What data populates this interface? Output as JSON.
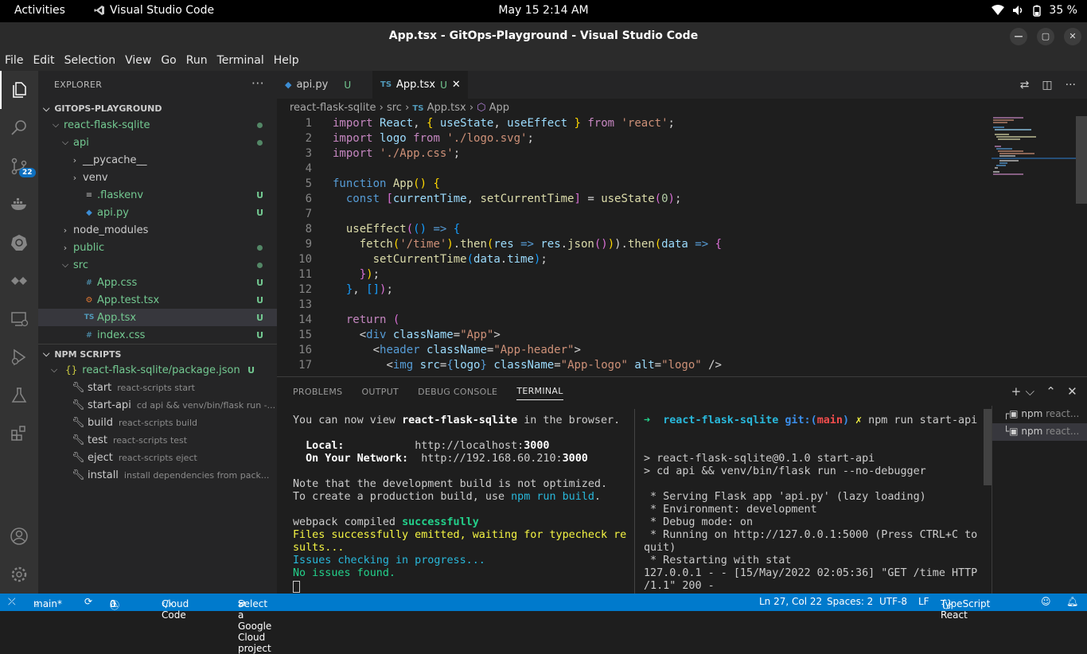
{
  "topbar": {
    "activities": "Activities",
    "app_name": "Visual Studio Code",
    "clock": "May 15  2:14 AM",
    "battery": "35 %"
  },
  "window": {
    "title": "App.tsx - GitOps-Playground - Visual Studio Code"
  },
  "menu": [
    "File",
    "Edit",
    "Selection",
    "View",
    "Go",
    "Run",
    "Terminal",
    "Help"
  ],
  "activity": {
    "scm_badge": "22"
  },
  "explorer": {
    "header": "EXPLORER",
    "more": "···",
    "workspace": "GITOPS-PLAYGROUND",
    "tree": [
      {
        "label": "react-flask-sqlite",
        "chev": "⌵",
        "indent": 1,
        "status": "dot"
      },
      {
        "label": "api",
        "chev": "⌵",
        "indent": 2,
        "status": "dot"
      },
      {
        "label": "__pycache__",
        "chev": "›",
        "indent": 3,
        "status": ""
      },
      {
        "label": "venv",
        "chev": "›",
        "indent": 3,
        "status": ""
      },
      {
        "label": ".flaskenv",
        "icon": "≡",
        "indent": 3,
        "status": "U"
      },
      {
        "label": "api.py",
        "icon": "py",
        "indent": 3,
        "status": "U"
      },
      {
        "label": "node_modules",
        "chev": "›",
        "indent": 2,
        "status": ""
      },
      {
        "label": "public",
        "chev": "›",
        "indent": 2,
        "status": "dot"
      },
      {
        "label": "src",
        "chev": "⌵",
        "indent": 2,
        "status": "dot"
      },
      {
        "label": "App.css",
        "icon": "#",
        "indent": 3,
        "status": "U"
      },
      {
        "label": "App.test.tsx",
        "icon": "⚙",
        "indent": 3,
        "status": "U"
      },
      {
        "label": "App.tsx",
        "icon": "TS",
        "indent": 3,
        "status": "U",
        "selected": true
      },
      {
        "label": "index.css",
        "icon": "#",
        "indent": 3,
        "status": "U"
      }
    ]
  },
  "npm": {
    "header": "NPM SCRIPTS",
    "package": "react-flask-sqlite/package.json",
    "package_status": "U",
    "scripts": [
      {
        "name": "start",
        "cmd": "react-scripts start"
      },
      {
        "name": "start-api",
        "cmd": "cd api && venv/bin/flask run -..."
      },
      {
        "name": "build",
        "cmd": "react-scripts build"
      },
      {
        "name": "test",
        "cmd": "react-scripts test"
      },
      {
        "name": "eject",
        "cmd": "react-scripts eject"
      },
      {
        "name": "install",
        "cmd": "install dependencies from pack..."
      }
    ]
  },
  "tabs": [
    {
      "label": "api.py",
      "status": "U"
    },
    {
      "label": "App.tsx",
      "status": "U",
      "active": true
    }
  ],
  "breadcrumb": [
    "react-flask-sqlite",
    "src",
    "App.tsx",
    "App"
  ],
  "code": [
    [
      [
        "k",
        "import"
      ],
      [
        "v",
        " React"
      ],
      [
        "p",
        ", "
      ],
      [
        "y",
        "{"
      ],
      [
        "v",
        " useState"
      ],
      [
        "p",
        ","
      ],
      [
        "v",
        " useEffect "
      ],
      [
        "y",
        "}"
      ],
      [
        "k",
        " from"
      ],
      [
        "s",
        " 'react'"
      ],
      [
        "p",
        ";"
      ]
    ],
    [
      [
        "k",
        "import"
      ],
      [
        "v",
        " logo"
      ],
      [
        "k",
        " from"
      ],
      [
        "s",
        " './logo.svg'"
      ],
      [
        "p",
        ";"
      ]
    ],
    [
      [
        "k",
        "import"
      ],
      [
        "s",
        " './App.css'"
      ],
      [
        "p",
        ";"
      ]
    ],
    [],
    [
      [
        "tg",
        "function"
      ],
      [
        "f",
        " App"
      ],
      [
        "y",
        "()"
      ],
      [
        "y",
        " {"
      ]
    ],
    [
      [
        "p",
        "  "
      ],
      [
        "tg",
        "const"
      ],
      [
        "d",
        " ["
      ],
      [
        "v",
        "currentTime"
      ],
      [
        "p",
        ", "
      ],
      [
        "f",
        "setCurrentTime"
      ],
      [
        "d",
        "]"
      ],
      [
        "p",
        " = "
      ],
      [
        "f",
        "useState"
      ],
      [
        "d",
        "("
      ],
      [
        "n",
        "0"
      ],
      [
        "d",
        ")"
      ],
      [
        "p",
        ";"
      ]
    ],
    [],
    [
      [
        "p",
        "  "
      ],
      [
        "f",
        "useEffect"
      ],
      [
        "d",
        "("
      ],
      [
        "b",
        "()"
      ],
      [
        "tg",
        " =>"
      ],
      [
        "b",
        " {"
      ]
    ],
    [
      [
        "p",
        "    "
      ],
      [
        "f",
        "fetch"
      ],
      [
        "y",
        "("
      ],
      [
        "s",
        "'/time'"
      ],
      [
        "y",
        ")"
      ],
      [
        "p",
        "."
      ],
      [
        "f",
        "then"
      ],
      [
        "y",
        "("
      ],
      [
        "v",
        "res"
      ],
      [
        "tg",
        " =>"
      ],
      [
        "v",
        " res"
      ],
      [
        "p",
        "."
      ],
      [
        "f",
        "json"
      ],
      [
        "d",
        "()"
      ],
      [
        "y",
        ")"
      ],
      [
        "p",
        ")."
      ],
      [
        "f",
        "then"
      ],
      [
        "y",
        "("
      ],
      [
        "v",
        "data"
      ],
      [
        "tg",
        " =>"
      ],
      [
        "d",
        " {"
      ]
    ],
    [
      [
        "p",
        "      "
      ],
      [
        "f",
        "setCurrentTime"
      ],
      [
        "b",
        "("
      ],
      [
        "v",
        "data"
      ],
      [
        "p",
        "."
      ],
      [
        "v",
        "time"
      ],
      [
        "b",
        ")"
      ],
      [
        "p",
        ";"
      ]
    ],
    [
      [
        "p",
        "    "
      ],
      [
        "d",
        "}"
      ],
      [
        "y",
        ")"
      ],
      [
        "p",
        ";"
      ]
    ],
    [
      [
        "p",
        "  "
      ],
      [
        "b",
        "}"
      ],
      [
        "p",
        ", "
      ],
      [
        "b",
        "[]"
      ],
      [
        "d",
        ")"
      ],
      [
        "p",
        ";"
      ]
    ],
    [],
    [
      [
        "p",
        "  "
      ],
      [
        "k",
        "return"
      ],
      [
        "d",
        " ("
      ]
    ],
    [
      [
        "p",
        "    "
      ],
      [
        "o",
        "<"
      ],
      [
        "tg",
        "div"
      ],
      [
        "v",
        " className"
      ],
      [
        "p",
        "="
      ],
      [
        "s",
        "\"App\""
      ],
      [
        "o",
        ">"
      ]
    ],
    [
      [
        "p",
        "      "
      ],
      [
        "o",
        "<"
      ],
      [
        "tg",
        "header"
      ],
      [
        "v",
        " className"
      ],
      [
        "p",
        "="
      ],
      [
        "s",
        "\"App-header\""
      ],
      [
        "o",
        ">"
      ]
    ],
    [
      [
        "p",
        "        "
      ],
      [
        "o",
        "<"
      ],
      [
        "tg",
        "img"
      ],
      [
        "v",
        " src"
      ],
      [
        "p",
        "="
      ],
      [
        "tg",
        "{"
      ],
      [
        "v",
        "logo"
      ],
      [
        "tg",
        "}"
      ],
      [
        "v",
        " className"
      ],
      [
        "p",
        "="
      ],
      [
        "s",
        "\"App-logo\""
      ],
      [
        "v",
        " alt"
      ],
      [
        "p",
        "="
      ],
      [
        "s",
        "\"logo\""
      ],
      [
        "o",
        " />"
      ]
    ]
  ],
  "panel": {
    "tabs": [
      "PROBLEMS",
      "OUTPUT",
      "DEBUG CONSOLE",
      "TERMINAL"
    ],
    "active_tab": "TERMINAL"
  },
  "terminal_left": [
    [
      [
        "w",
        "You can now view "
      ],
      [
        "wb",
        "react-flask-sqlite"
      ],
      [
        "w",
        " in the browser."
      ]
    ],
    [],
    [
      [
        "wb",
        "  Local:           "
      ],
      [
        "w",
        "http://localhost:"
      ],
      [
        "wb",
        "3000"
      ]
    ],
    [
      [
        "wb",
        "  On Your Network: "
      ],
      [
        "w",
        " http://192.168.60.210:"
      ],
      [
        "wb",
        "3000"
      ]
    ],
    [],
    [
      [
        "w",
        "Note that the development build is not optimized."
      ]
    ],
    [
      [
        "w",
        "To create a production build, use "
      ],
      [
        "c",
        "npm run build"
      ],
      [
        "w",
        "."
      ]
    ],
    [],
    [
      [
        "w",
        "webpack compiled "
      ],
      [
        "g",
        "successfully"
      ]
    ],
    [
      [
        "yl",
        "Files successfully emitted, waiting for typecheck re"
      ]
    ],
    [
      [
        "yl",
        "sults..."
      ]
    ],
    [
      [
        "c",
        "Issues checking in progress..."
      ]
    ],
    [
      [
        "g2",
        "No issues found."
      ]
    ]
  ],
  "terminal_right": [
    [
      [
        "g2",
        "➜  "
      ],
      [
        "c2",
        "react-flask-sqlite "
      ],
      [
        "bl",
        "git:("
      ],
      [
        "r",
        "main"
      ],
      [
        "bl",
        ")"
      ],
      [
        "yl",
        " ✗"
      ],
      [
        "w",
        " npm run start-api"
      ]
    ],
    [],
    [],
    [
      [
        "w",
        "> react-flask-sqlite@0.1.0 start-api"
      ]
    ],
    [
      [
        "w",
        "> cd api && venv/bin/flask run --no-debugger"
      ]
    ],
    [],
    [
      [
        "w",
        " * Serving Flask app 'api.py' (lazy loading)"
      ]
    ],
    [
      [
        "w",
        " * Environment: development"
      ]
    ],
    [
      [
        "w",
        " * Debug mode: on"
      ]
    ],
    [
      [
        "w",
        " * Running on http://127.0.0.1:5000 (Press CTRL+C to"
      ]
    ],
    [
      [
        "w",
        "quit)"
      ]
    ],
    [
      [
        "w",
        " * Restarting with stat"
      ]
    ],
    [
      [
        "w",
        "127.0.0.1 - - [15/May/2022 02:05:36] \"GET /time HTTP"
      ]
    ],
    [
      [
        "w",
        "/1.1\" 200 -"
      ]
    ]
  ],
  "terminal_list": [
    "npm",
    "react...",
    "npm",
    "react..."
  ],
  "status": {
    "branch": "main*",
    "errors": "0",
    "warnings": "0",
    "cloud_code": "Cloud Code",
    "gcp": "Select a Google Cloud project",
    "position": "Ln 27, Col 22",
    "spaces": "Spaces: 2",
    "encoding": "UTF-8",
    "eol": "LF",
    "language": "TypeScript React"
  },
  "colors": {
    "accent": "#007acc",
    "modified": "#73c991"
  }
}
